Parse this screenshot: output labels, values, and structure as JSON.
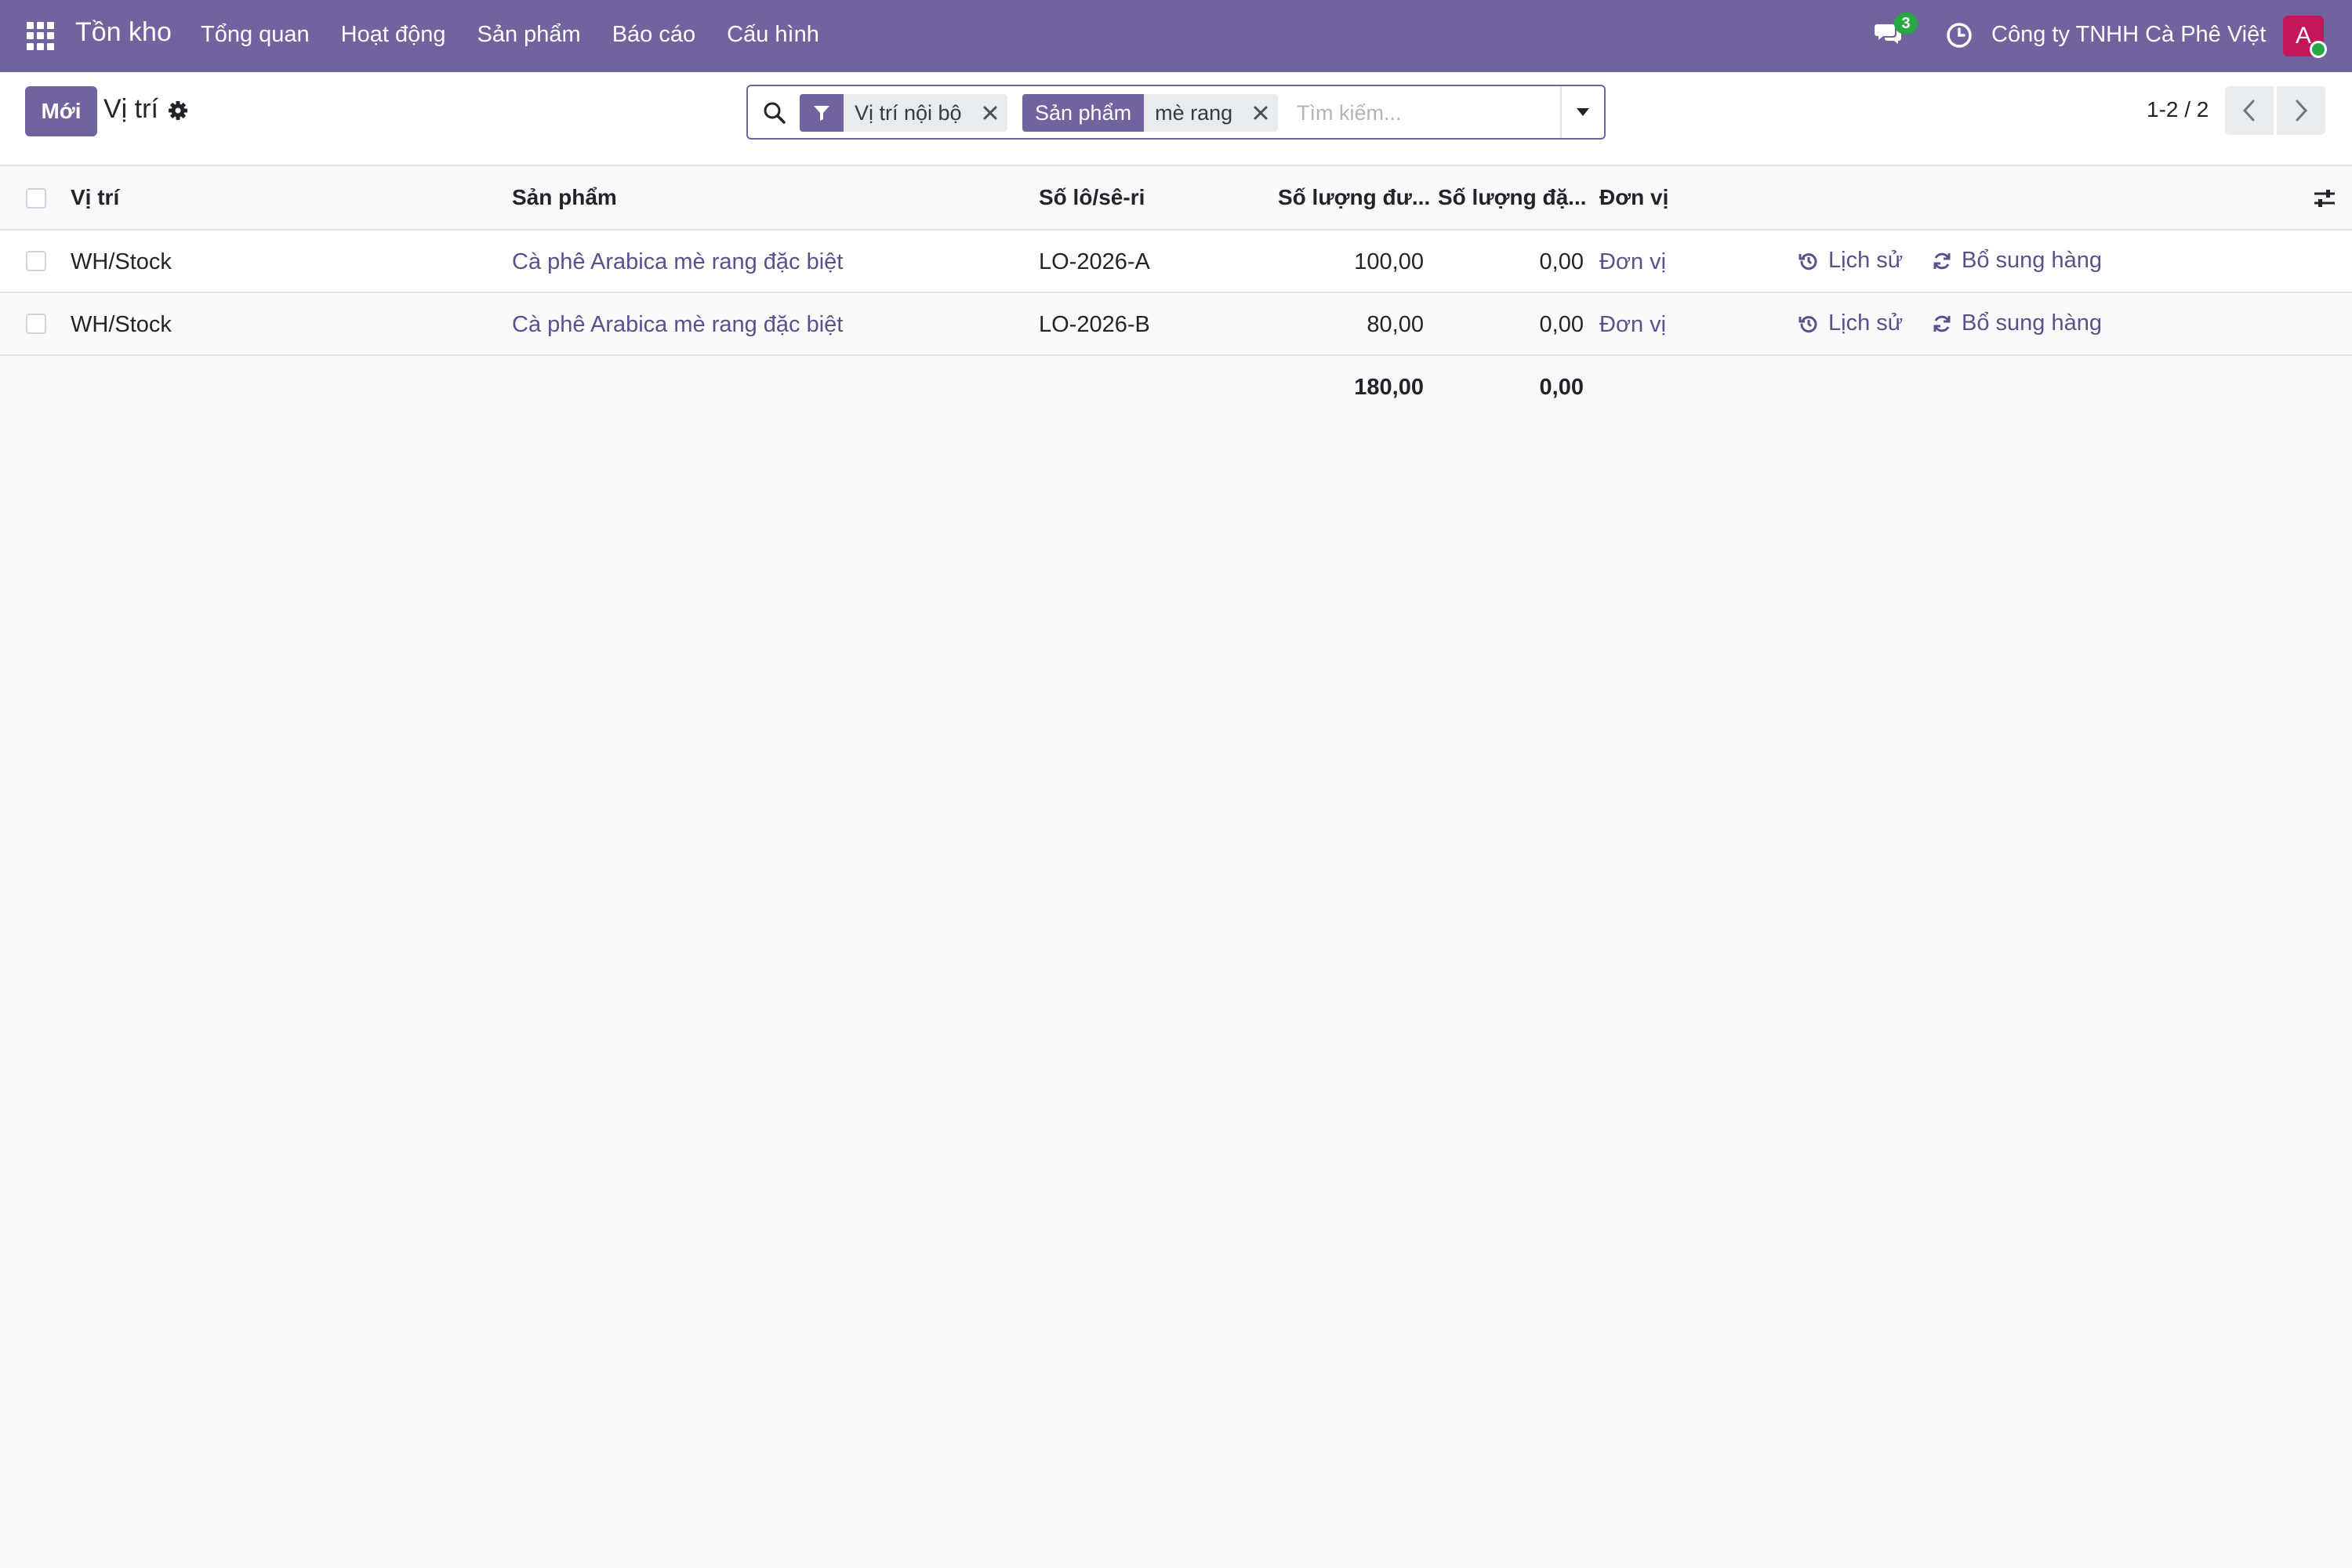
{
  "navbar": {
    "app_title": "Tồn kho",
    "menu": [
      "Tổng quan",
      "Hoạt động",
      "Sản phẩm",
      "Báo cáo",
      "Cấu hình"
    ],
    "chat_count": "3",
    "company": "Công ty TNHH Cà Phê Việt",
    "avatar_letter": "A",
    "colors": {
      "navbar_bg": "#71639e",
      "avatar_bg": "#c2185b",
      "badge_bg": "#28a745"
    }
  },
  "control_panel": {
    "new_button": "Mới",
    "breadcrumb": "Vị trí",
    "search": {
      "facet_filter_label": "Vị trí nội bộ",
      "facet_product_name": "Sản phẩm",
      "facet_product_value": "mè rang",
      "placeholder": "Tìm kiếm..."
    },
    "pager": "1-2 / 2"
  },
  "table": {
    "columns": [
      "Vị trí",
      "Sản phẩm",
      "Số lô/sê-ri",
      "Số lượng đư...",
      "Số lượng đặ...",
      "Đơn vị"
    ],
    "rows": [
      {
        "location": "WH/Stock",
        "product": "Cà phê Arabica mè rang đặc biệt",
        "lot": "LO-2026-A",
        "qty_on_hand": "100,00",
        "qty_reserved": "0,00",
        "uom": "Đơn vị",
        "history": "Lịch sử",
        "replenish": "Bổ sung hàng"
      },
      {
        "location": "WH/Stock",
        "product": "Cà phê Arabica mè rang đặc biệt",
        "lot": "LO-2026-B",
        "qty_on_hand": "80,00",
        "qty_reserved": "0,00",
        "uom": "Đơn vị",
        "history": "Lịch sử",
        "replenish": "Bổ sung hàng"
      }
    ],
    "totals": {
      "qty_on_hand": "180,00",
      "qty_reserved": "0,00"
    }
  }
}
